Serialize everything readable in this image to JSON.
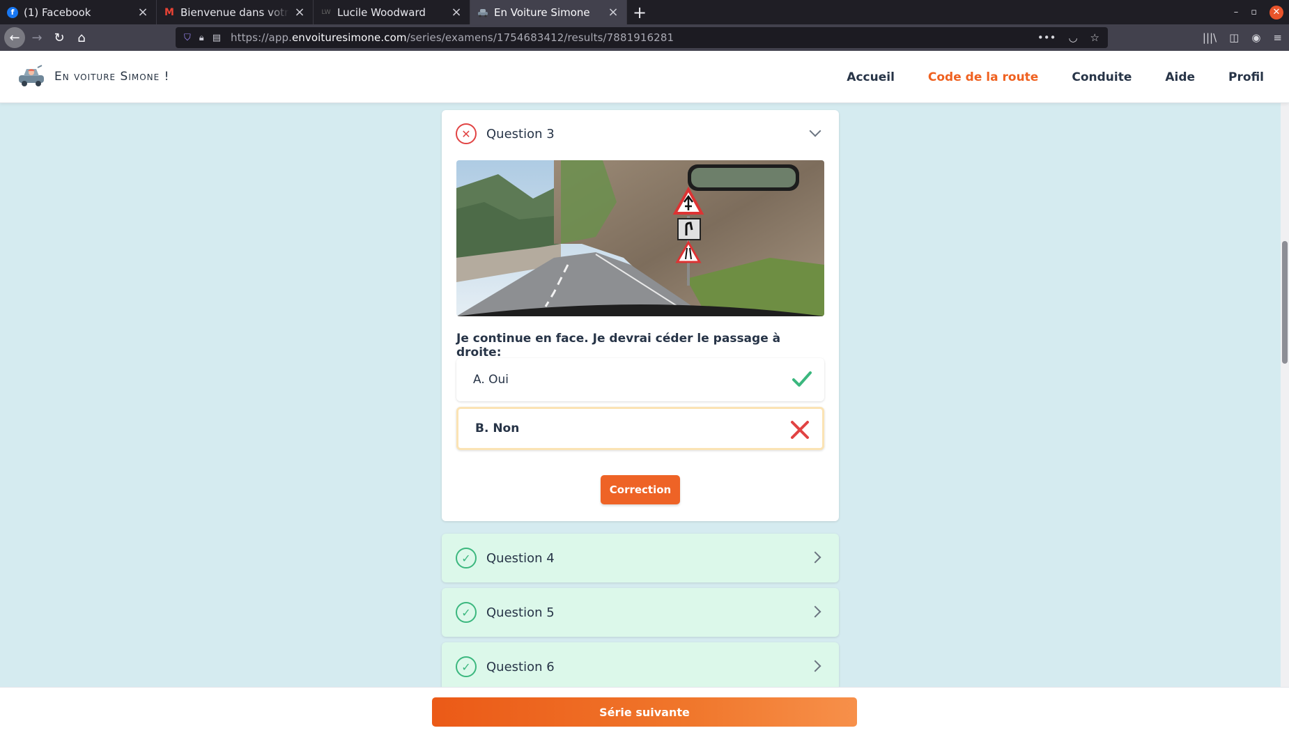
{
  "browser": {
    "tabs": [
      {
        "title": "(1) Facebook",
        "favicon": "facebook-icon"
      },
      {
        "title": "Bienvenue dans votre pr",
        "favicon": "gmail-icon"
      },
      {
        "title": "Lucile Woodward",
        "favicon": "lw-icon"
      },
      {
        "title": "En Voiture Simone",
        "favicon": "car-icon",
        "active": true
      }
    ],
    "url_prefix": "https://app.",
    "url_domain": "envoituresimone.com",
    "url_path": "/series/examens/1754683412/results/7881916281"
  },
  "site": {
    "brand": "En voiture Simone !",
    "menu": [
      "Accueil",
      "Code de la route",
      "Conduite",
      "Aide",
      "Profil"
    ],
    "active_menu": "Code de la route",
    "accent_color": "#ef6120"
  },
  "question3": {
    "label": "Question 3",
    "status": "wrong",
    "text": "Je continue en face. Je devrai céder le passage à droite:",
    "answers": [
      {
        "label": "A. Oui",
        "mark": "check",
        "selected": false
      },
      {
        "label": "B. Non",
        "mark": "cross",
        "selected": true
      }
    ],
    "correction_label": "Correction"
  },
  "collapsed_questions": [
    {
      "label": "Question 4",
      "status": "correct"
    },
    {
      "label": "Question 5",
      "status": "correct"
    },
    {
      "label": "Question 6",
      "status": "correct"
    }
  ],
  "footer": {
    "next_label": "Série suivante"
  }
}
